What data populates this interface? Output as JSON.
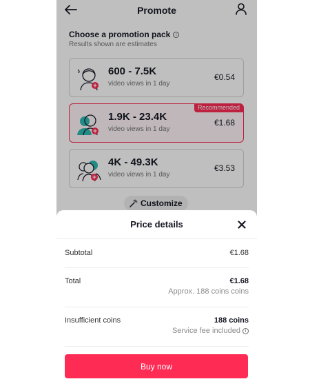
{
  "header": {
    "title": "Promote",
    "back_icon": "arrow-left-icon",
    "profile_icon": "person-icon"
  },
  "section": {
    "title": "Choose a promotion pack",
    "subtitle": "Results shown are estimates"
  },
  "packs": [
    {
      "range": "600 - 7.5K",
      "desc": "video views in 1 day",
      "price": "€0.54",
      "selected": false
    },
    {
      "range": "1.9K - 23.4K",
      "desc": "video views in 1 day",
      "price": "€1.68",
      "selected": true,
      "badge": "Recommended"
    },
    {
      "range": "4K - 49.3K",
      "desc": "video views in 1 day",
      "price": "€3.53",
      "selected": false
    }
  ],
  "customize": {
    "label": "Customize"
  },
  "sheet": {
    "title": "Price details",
    "subtotal_label": "Subtotal",
    "subtotal_value": "€1.68",
    "total_label": "Total",
    "total_value": "€1.68",
    "total_sub": "Approx. 188 coins coins",
    "insufficient_label": "Insufficient coins",
    "insufficient_value": "188 coins",
    "insufficient_sub": "Service fee included",
    "buy_label": "Buy now"
  },
  "colors": {
    "accent": "#fe2c55",
    "text": "#161823",
    "muted": "#757575"
  }
}
